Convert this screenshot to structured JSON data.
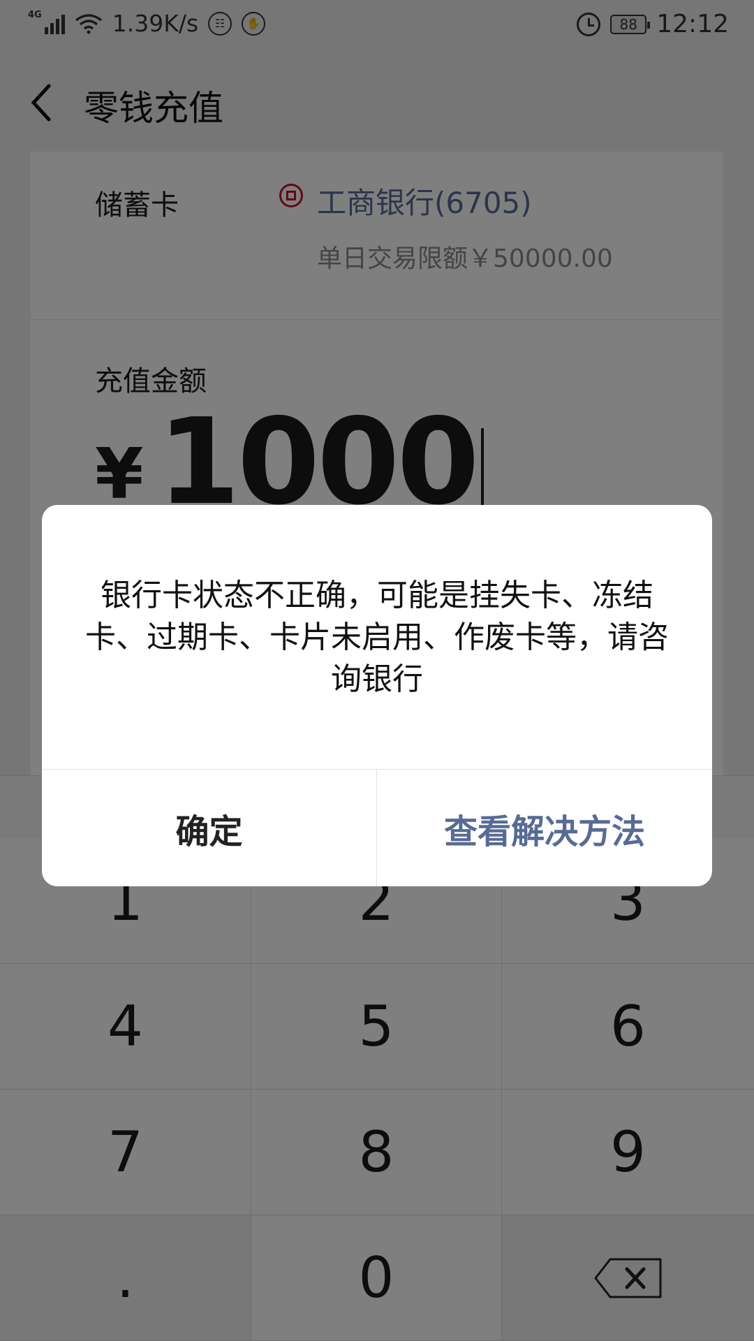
{
  "status_bar": {
    "network_type": "4G",
    "net_speed": "1.39K/s",
    "battery": "88",
    "time": "12:12"
  },
  "header": {
    "title": "零钱充值",
    "back_icon": "chevron-left-icon"
  },
  "card": {
    "label": "储蓄卡",
    "bank_name": "工商银行(6705)",
    "limit_text": "单日交易限额￥50000.00"
  },
  "amount": {
    "label": "充值金额",
    "currency_symbol": "¥",
    "value": "1000"
  },
  "keypad": {
    "keys": [
      "1",
      "2",
      "3",
      "4",
      "5",
      "6",
      "7",
      "8",
      "9",
      ".",
      "0"
    ],
    "backspace_icon": "backspace-icon"
  },
  "dialog": {
    "message": "银行卡状态不正确，可能是挂失卡、冻结卡、过期卡、卡片未启用、作废卡等，请咨询银行",
    "ok_label": "确定",
    "solve_label": "查看解决方法"
  },
  "colors": {
    "link": "#576b95",
    "bank_red": "#c8102e",
    "overlay": "rgba(0,0,0,0.5)"
  }
}
